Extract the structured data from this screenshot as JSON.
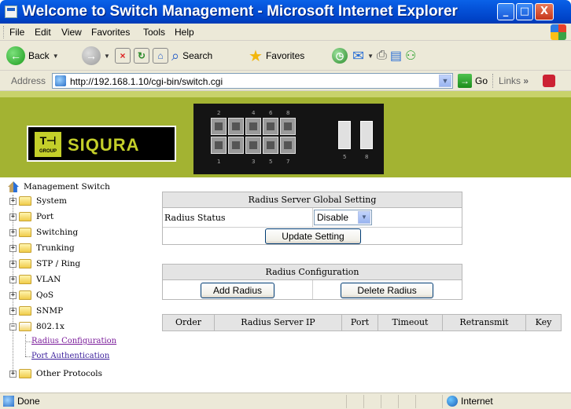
{
  "window": {
    "title": "Welcome to Switch Management - Microsoft Internet Explorer",
    "min": "_",
    "max": "□",
    "close": "X"
  },
  "menu": [
    "File",
    "Edit",
    "View",
    "Favorites",
    "Tools",
    "Help"
  ],
  "toolbar": {
    "back": "Back",
    "search": "Search",
    "favorites": "Favorites"
  },
  "address": {
    "label": "Address",
    "url": "http://192.168.1.10/cgi-bin/switch.cgi",
    "go": "Go",
    "links": "Links",
    "links_chevron": "»"
  },
  "banner": {
    "logo_group": "T⊣",
    "logo_group_sub": "GROUP",
    "brand": "SIQURA",
    "ports_top": [
      "2",
      "4",
      "6",
      "8"
    ],
    "ports_bottom": [
      "1",
      "3",
      "5",
      "7"
    ],
    "sfp_labels": [
      "5",
      "8"
    ]
  },
  "tree": {
    "root": "Management Switch",
    "folders": [
      "System",
      "Port",
      "Switching",
      "Trunking",
      "STP / Ring",
      "VLAN",
      "QoS",
      "SNMP"
    ],
    "open_folder": "802.1x",
    "links": [
      "Radius Configuration",
      "Port Authentication"
    ],
    "last_folder": "Other Protocols",
    "plus": "+",
    "minus": "−"
  },
  "global_setting": {
    "title": "Radius Server Global Setting",
    "status_label": "Radius Status",
    "status_value": "Disable",
    "update_button": "Update Setting"
  },
  "radius_config": {
    "title": "Radius Configuration",
    "add_button": "Add Radius",
    "delete_button": "Delete Radius"
  },
  "table": {
    "columns": [
      "Order",
      "Radius Server IP",
      "Port",
      "Timeout",
      "Retransmit",
      "Key"
    ]
  },
  "status": {
    "text": "Done",
    "zone": "Internet"
  }
}
